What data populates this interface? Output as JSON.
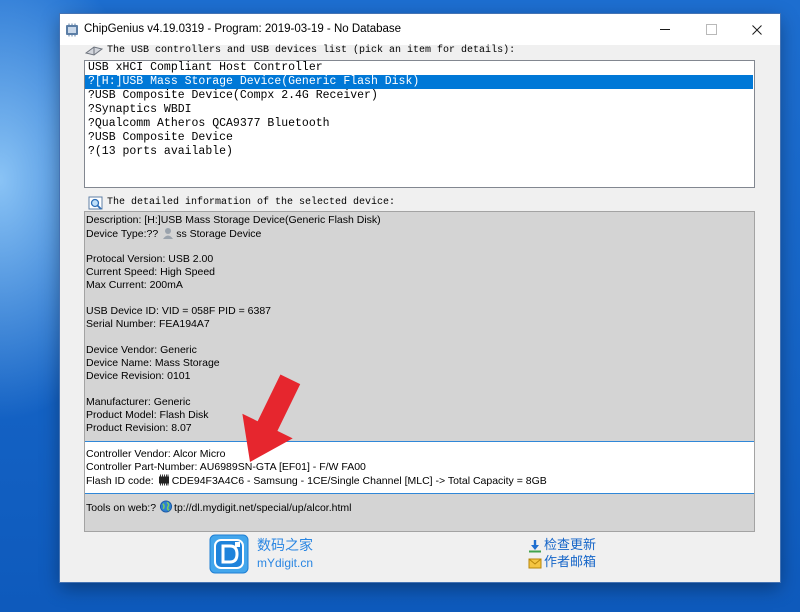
{
  "window": {
    "title": "ChipGenius v4.19.0319 - Program: 2019-03-19 - No Database"
  },
  "device_list": {
    "label": "The USB controllers and USB devices list (pick an item for details):",
    "selected_index": 1,
    "items": [
      "USB xHCI Compliant Host Controller",
      "?[H:]USB Mass Storage Device(Generic Flash Disk)",
      "?USB Composite Device(Compx 2.4G Receiver)",
      "?Synaptics WBDI",
      "?Qualcomm Atheros QCA9377 Bluetooth",
      "?USB Composite Device",
      "?(13 ports available)"
    ]
  },
  "details": {
    "label": "The detailed information of the selected device:",
    "description": "Description: [H:]USB Mass Storage Device(Generic Flash Disk)",
    "device_type": {
      "prefix": "Device Type:??",
      "suffix": "ss Storage Device"
    },
    "protocol_version": "Protocal Version: USB 2.00",
    "current_speed": "Current Speed: High Speed",
    "max_current": "Max Current: 200mA",
    "usb_device_id": "USB Device ID: VID = 058F PID = 6387",
    "serial_number": "Serial Number: FEA194A7",
    "device_vendor": "Device Vendor: Generic",
    "device_name": "Device Name: Mass Storage",
    "device_revision": "Device Revision: 0101",
    "manufacturer": "Manufacturer: Generic",
    "product_model": "Product Model: Flash Disk",
    "product_revision": "Product Revision: 8.07",
    "controller_vendor": "Controller Vendor: Alcor Micro",
    "controller_part_number": "Controller Part-Number: AU6989SN-GTA [EF01] - F/W FA00",
    "flash_id": {
      "prefix": "Flash ID code:",
      "suffix": "CDE94F3A4C6 - Samsung - 1CE/Single Channel [MLC] -> Total Capacity = 8GB"
    },
    "tools_on_web": {
      "prefix": "Tools on web:?",
      "suffix": "tp://dl.mydigit.net/special/up/alcor.html"
    }
  },
  "footer": {
    "site_name": "数码之家",
    "site_url": "mYdigit.cn",
    "check_update": "检查更新",
    "author_email": "作者邮箱"
  },
  "icons": {
    "app": "chipgenius-app-icon",
    "minimize": "minimize-icon",
    "maximize": "maximize-icon",
    "close": "close-icon",
    "device_list": "usb-device-icon",
    "details": "magnifier-icon",
    "device_type": "storage-device-icon",
    "flash_id": "flash-chip-icon",
    "tools_on_web": "globe-icon",
    "footer_logo": "mydigit-logo-icon",
    "check_update": "update-icon",
    "author_email": "mail-icon"
  },
  "colors": {
    "selection": "#0078d7",
    "highlight_border": "#2f87d8",
    "footer_link": "#2a86e2",
    "annotation_arrow": "#e6262e"
  }
}
